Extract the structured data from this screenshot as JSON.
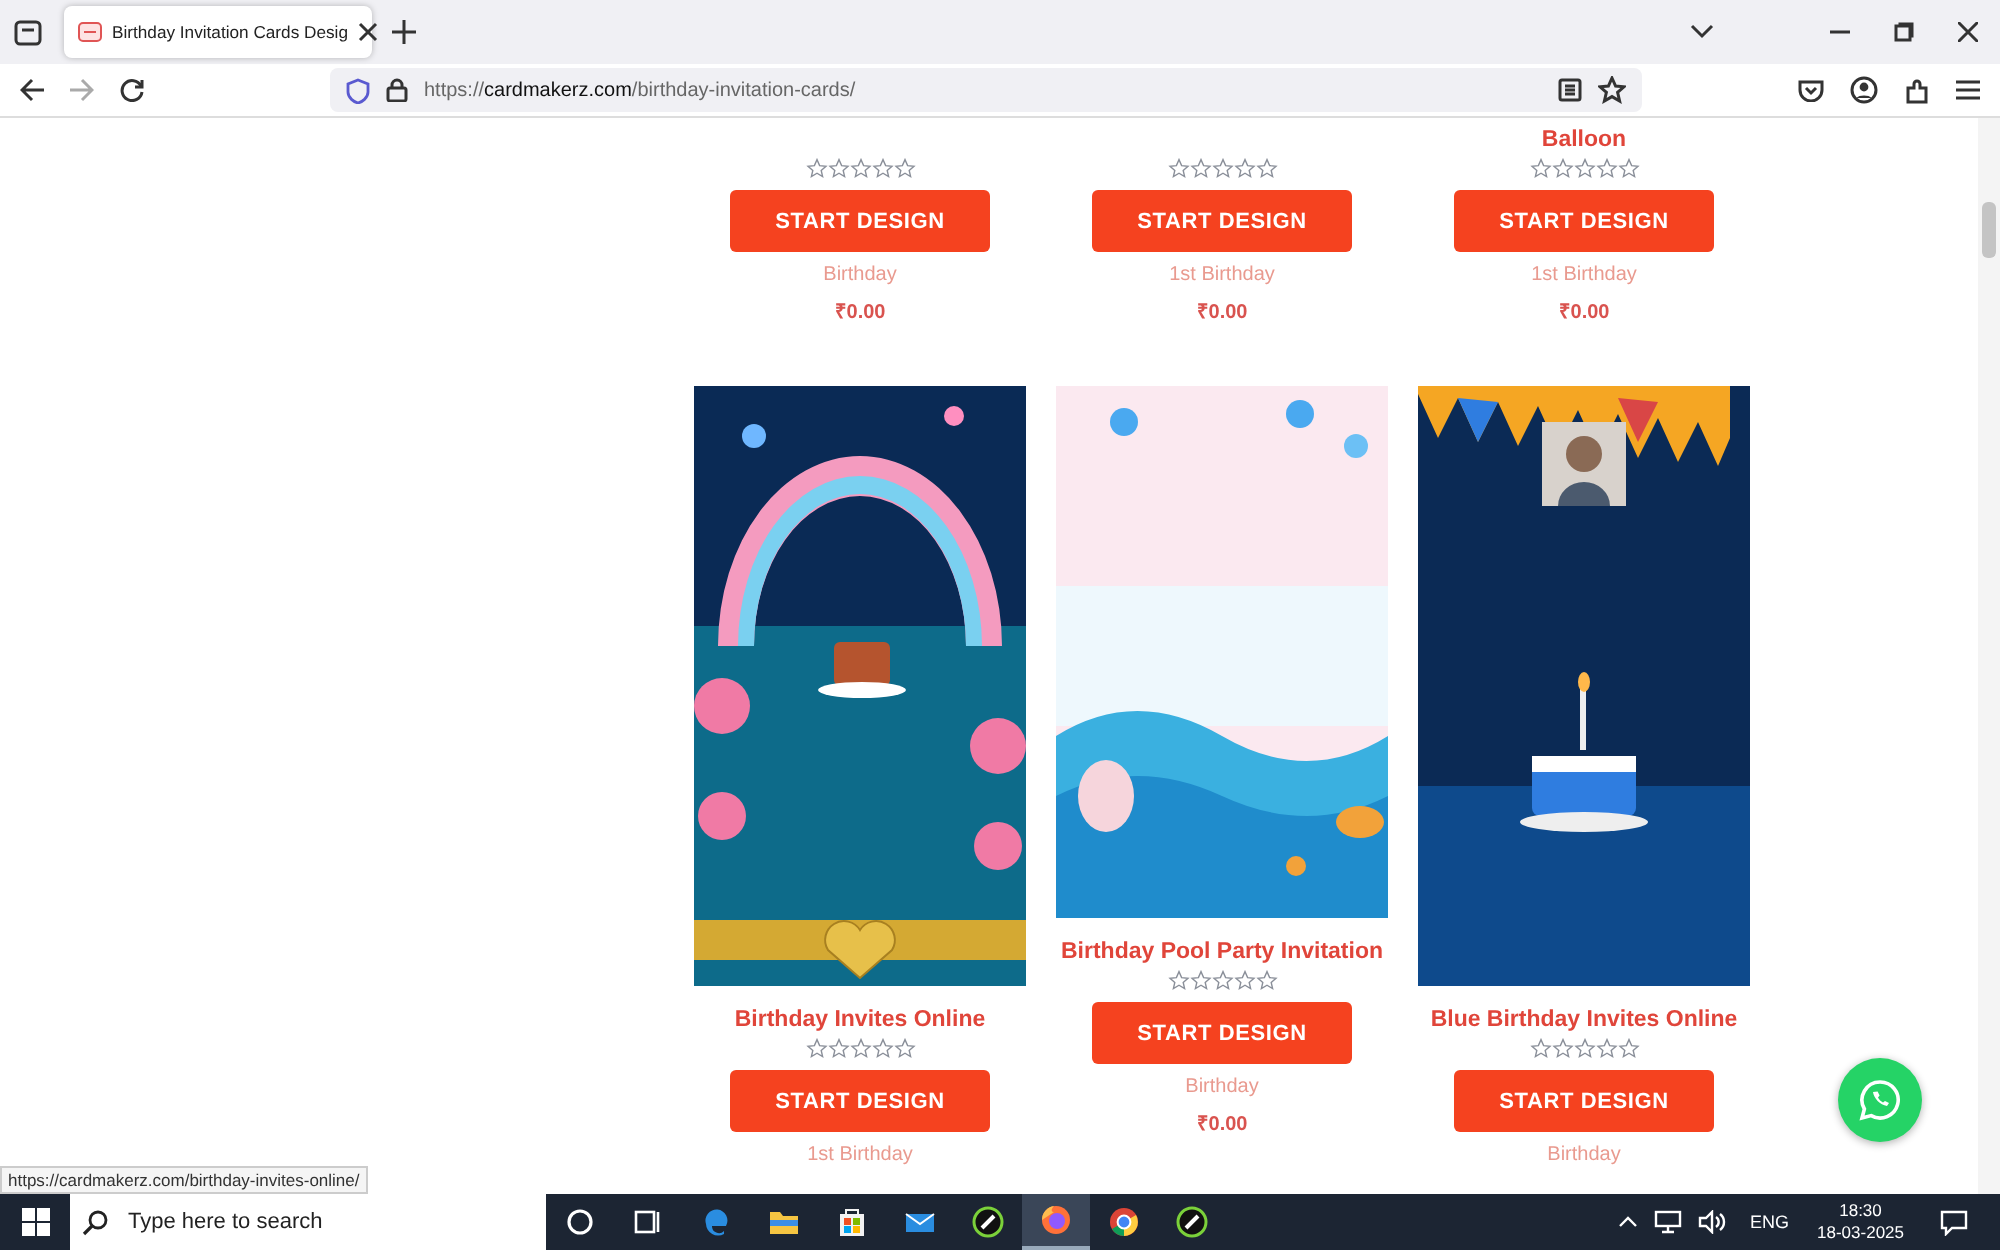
{
  "browser": {
    "tabs": [
      {
        "title": "Birthday Invitation Cards Desig",
        "selected": true
      }
    ],
    "address": {
      "scheme": "https://",
      "host": "cardmakerz.com",
      "path": "/birthday-invitation-cards/"
    }
  },
  "top_products": [
    {
      "stars": 0,
      "button": "START DESIGN",
      "category": "Birthday",
      "price": "₹0.00"
    },
    {
      "stars": 0,
      "button": "START DESIGN",
      "category": "1st Birthday",
      "price": "₹0.00"
    },
    {
      "title": "Balloon",
      "stars": 0,
      "button": "START DESIGN",
      "category": "1st Birthday",
      "price": "₹0.00"
    }
  ],
  "products": [
    {
      "title": "Birthday Invites Online",
      "stars": 0,
      "button": "START DESIGN",
      "category": "1st Birthday"
    },
    {
      "title": "Birthday Pool Party Invitation",
      "stars": 0,
      "button": "START DESIGN",
      "category": "Birthday",
      "price": "₹0.00"
    },
    {
      "title": "Blue Birthday Invites Online",
      "stars": 0,
      "button": "START DESIGN",
      "category": "Birthday"
    }
  ],
  "status_link": "https://cardmakerz.com/birthday-invites-online/",
  "taskbar": {
    "search": {
      "placeholder": "Type here to search"
    },
    "language": "ENG",
    "time": "18:30",
    "date": "18-03-2025"
  }
}
